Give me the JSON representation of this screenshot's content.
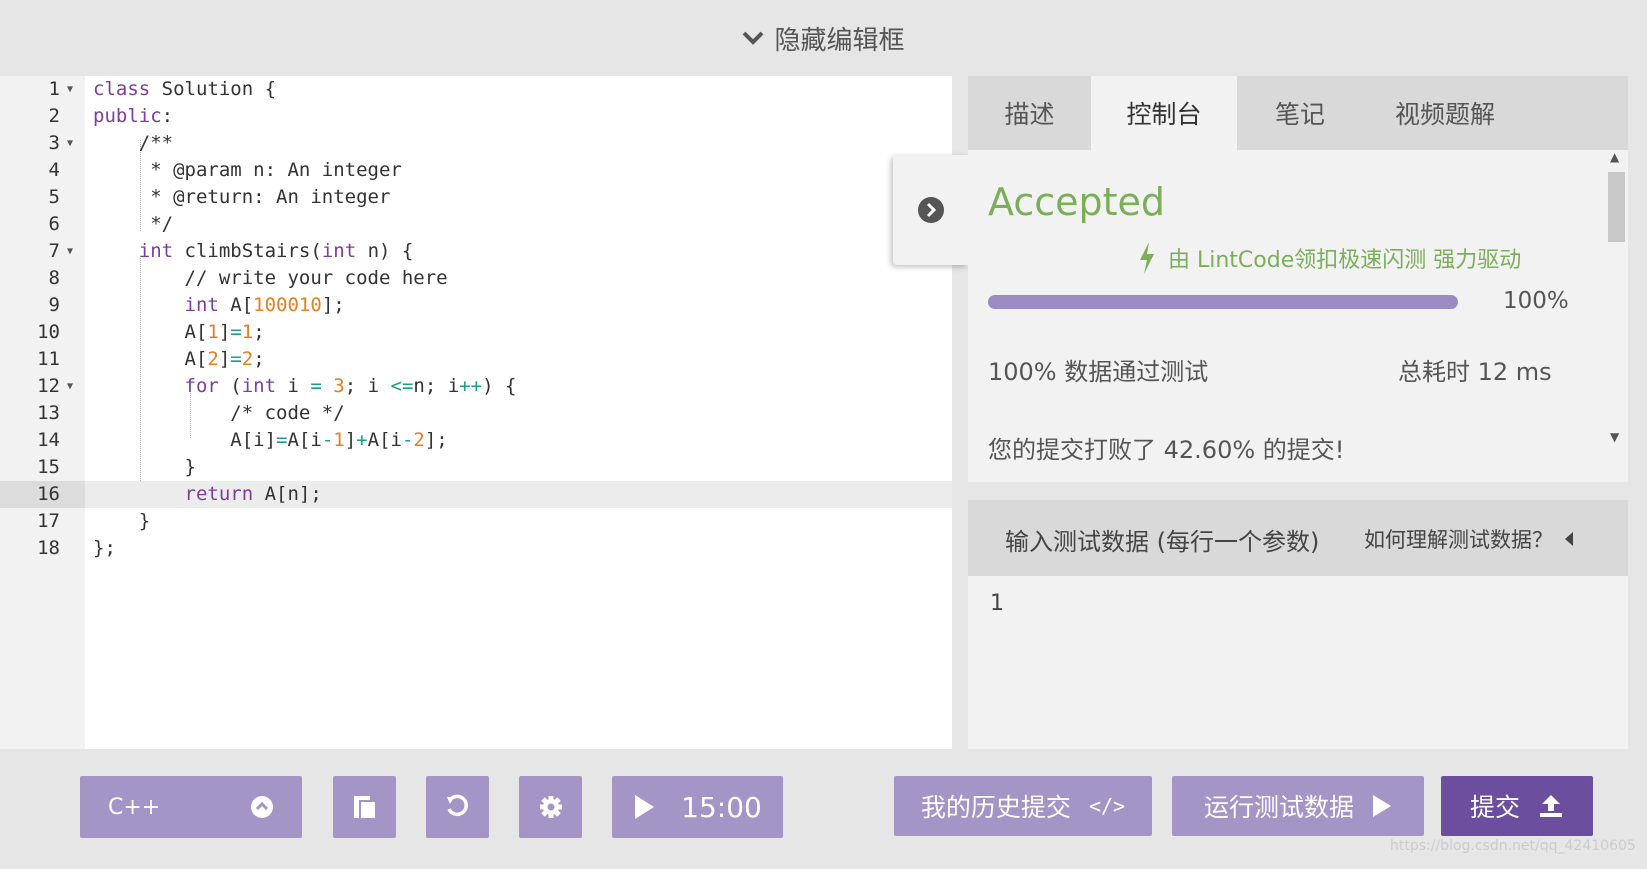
{
  "topbar": {
    "label": "隐藏编辑框"
  },
  "code": {
    "lines": [
      {
        "n": "1"
      },
      {
        "n": "2"
      },
      {
        "n": "3"
      },
      {
        "n": "4"
      },
      {
        "n": "5"
      },
      {
        "n": "6"
      },
      {
        "n": "7"
      },
      {
        "n": "8"
      },
      {
        "n": "9"
      },
      {
        "n": "10"
      },
      {
        "n": "11"
      },
      {
        "n": "12"
      },
      {
        "n": "13"
      },
      {
        "n": "14"
      },
      {
        "n": "15"
      },
      {
        "n": "16"
      },
      {
        "n": "17"
      },
      {
        "n": "18"
      }
    ],
    "active_line": 16
  },
  "tabs": [
    {
      "label": "描述"
    },
    {
      "label": "控制台"
    },
    {
      "label": "笔记"
    },
    {
      "label": "视频题解"
    }
  ],
  "result": {
    "status": "Accepted",
    "powered_by": "由 LintCode领扣极速闪测 强力驱动",
    "progress_pct_text": "100%",
    "progress_fraction": 1.0,
    "pass_text": "100% 数据通过测试",
    "time_text": "总耗时 12 ms",
    "beat_text": "您的提交打败了 42.60% 的提交!"
  },
  "test": {
    "header": "输入测试数据 (每行一个参数)",
    "help": "如何理解测试数据？",
    "value": "1"
  },
  "bottom": {
    "language": "C++",
    "timer": "15:00",
    "history": "我的历史提交",
    "run": "运行测试数据",
    "submit": "提交"
  },
  "watermark": "https://blog.csdn.net/qq_42410605",
  "colors": {
    "accent": "#a395c6",
    "submit": "#6b4f9e",
    "accepted": "#7cae5a"
  }
}
